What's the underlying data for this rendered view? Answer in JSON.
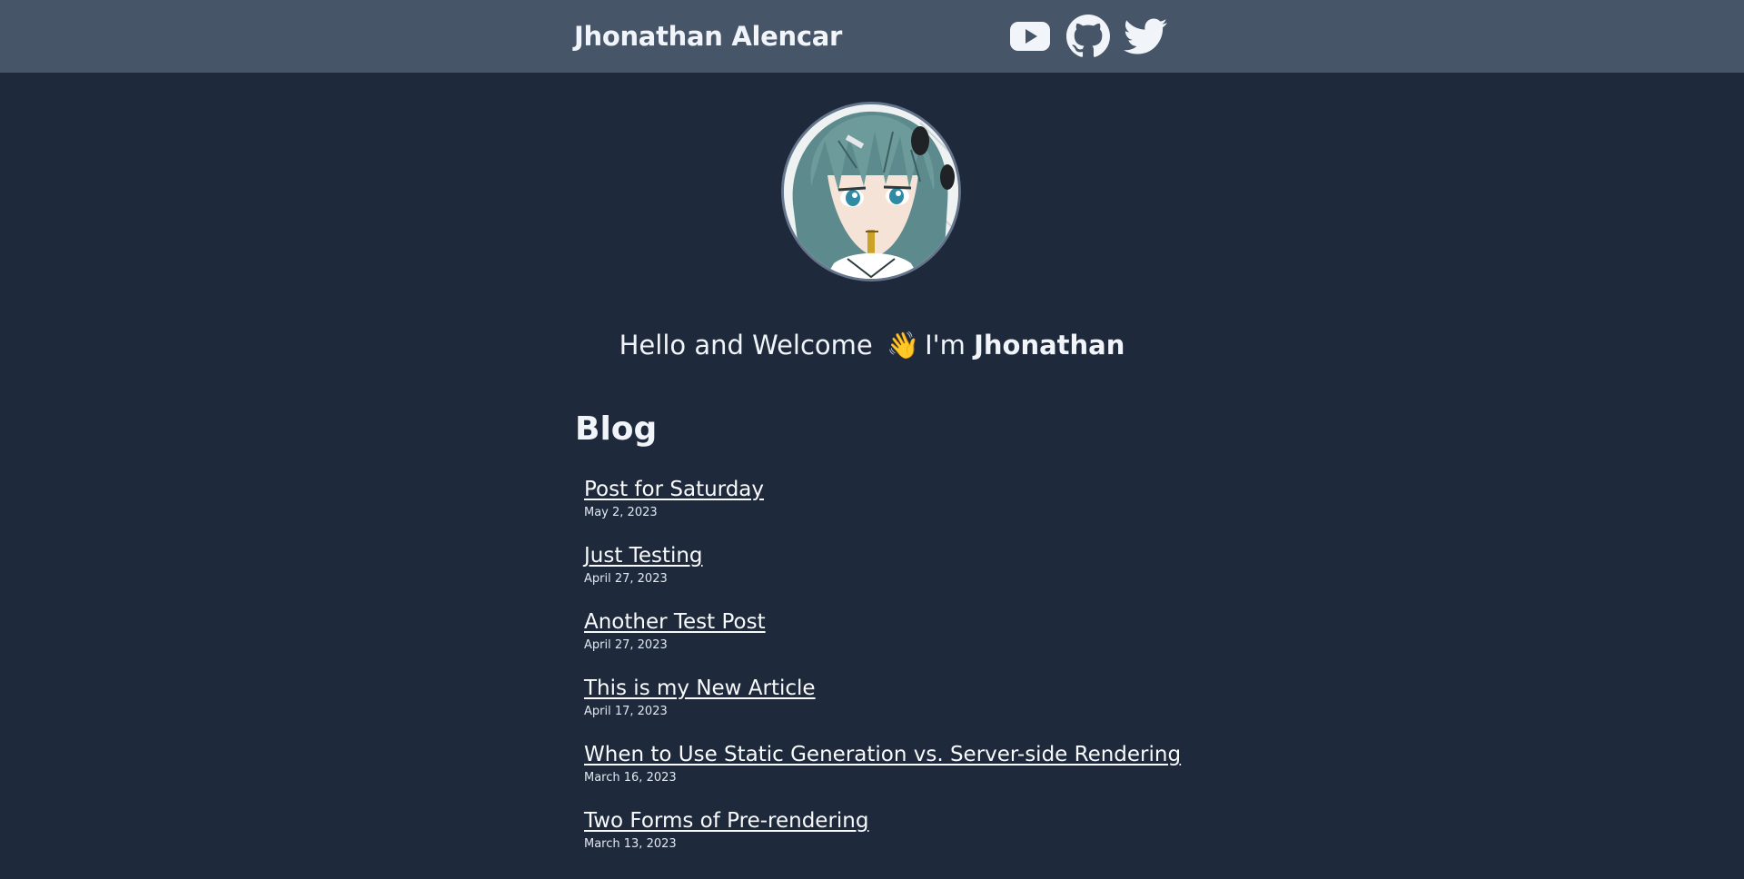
{
  "header": {
    "site_title": "Jhonathan Alencar",
    "social": [
      {
        "icon": "youtube-icon"
      },
      {
        "icon": "github-icon"
      },
      {
        "icon": "twitter-icon"
      }
    ]
  },
  "profile": {
    "greeting_prefix": "Hello and Welcome",
    "wave_emoji": "👋",
    "greeting_im": "I'm",
    "greeting_name": "Jhonathan"
  },
  "blog": {
    "heading": "Blog",
    "posts": [
      {
        "title": "Post for Saturday",
        "date": "May 2, 2023"
      },
      {
        "title": "Just Testing",
        "date": "April 27, 2023"
      },
      {
        "title": "Another Test Post",
        "date": "April 27, 2023"
      },
      {
        "title": "This is my New Article",
        "date": "April 17, 2023"
      },
      {
        "title": "When to Use Static Generation vs. Server-side Rendering",
        "date": "March 16, 2023"
      },
      {
        "title": "Two Forms of Pre-rendering",
        "date": "March 13, 2023"
      }
    ]
  },
  "colors": {
    "background": "#1e293b",
    "header_background": "#475569",
    "text": "#f1f5f9"
  }
}
